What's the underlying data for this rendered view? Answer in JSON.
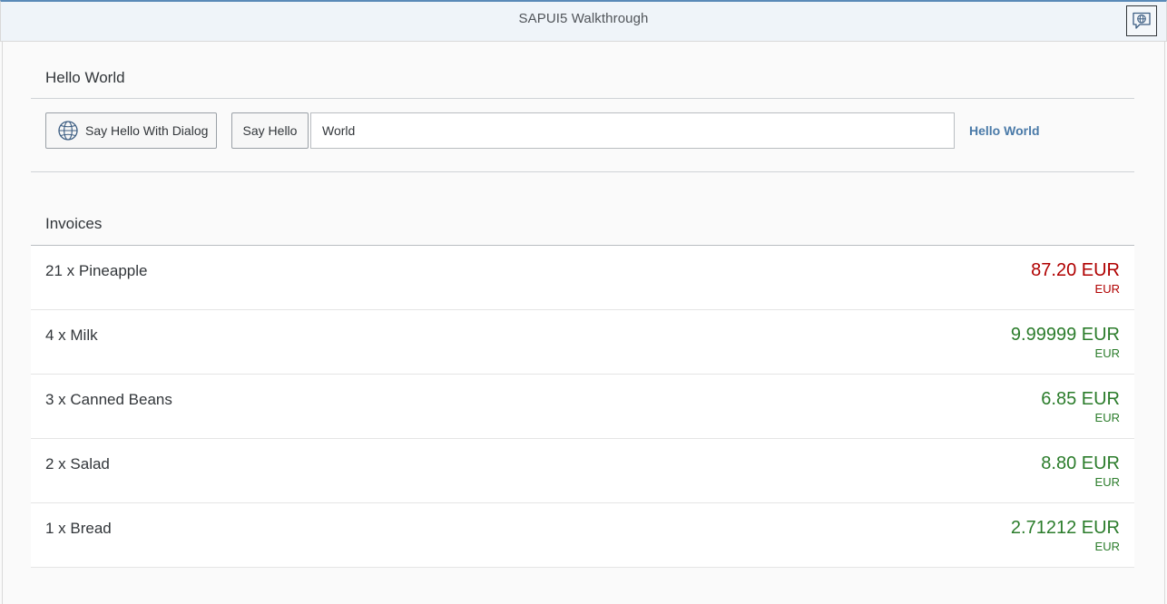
{
  "header": {
    "title": "SAPUI5 Walkthrough",
    "help_icon": "globe-speech-bubble-icon"
  },
  "hello_panel": {
    "title": "Hello World",
    "dialog_button_label": "Say Hello With Dialog",
    "dialog_button_icon": "globe-icon",
    "say_hello_label": "Say Hello",
    "input_value": "World",
    "greeting_text": "Hello World"
  },
  "invoices": {
    "title": "Invoices",
    "items": [
      {
        "title": "21 x Pineapple",
        "amount": "87.20 EUR",
        "unit": "EUR",
        "state": "error"
      },
      {
        "title": "4 x Milk",
        "amount": "9.99999 EUR",
        "unit": "EUR",
        "state": "success"
      },
      {
        "title": "3 x Canned Beans",
        "amount": "6.85 EUR",
        "unit": "EUR",
        "state": "success"
      },
      {
        "title": "2 x Salad",
        "amount": "8.80 EUR",
        "unit": "EUR",
        "state": "success"
      },
      {
        "title": "1 x Bread",
        "amount": "2.71212 EUR",
        "unit": "EUR",
        "state": "success"
      }
    ]
  },
  "colors": {
    "error": "#b00000",
    "success": "#2b7c2b",
    "link": "#4a7aa8",
    "header_bg": "#eff4f9"
  }
}
